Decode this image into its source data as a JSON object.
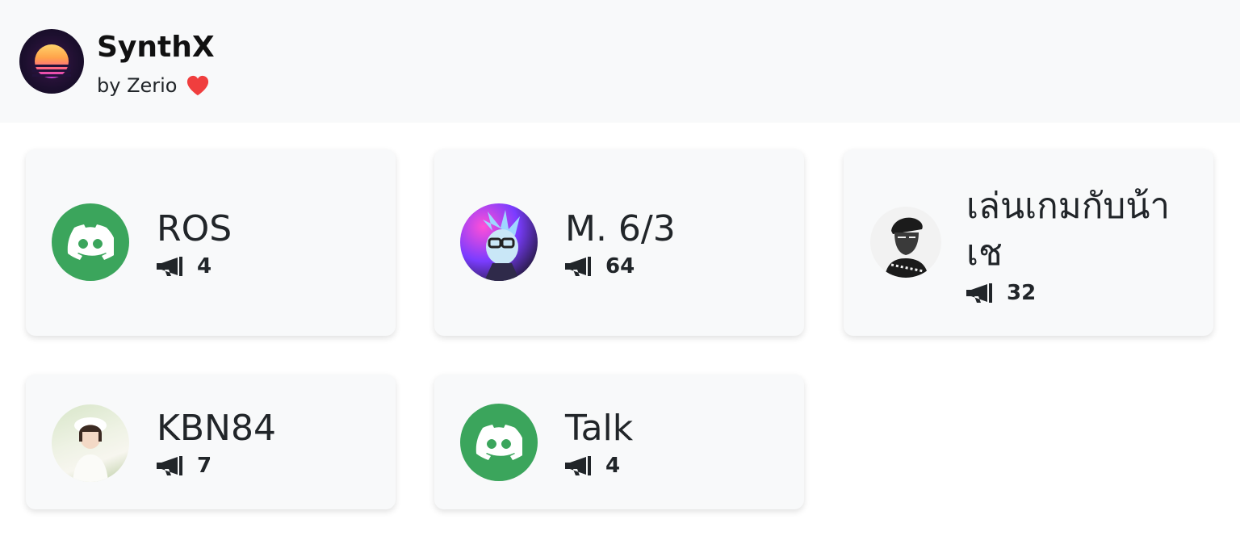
{
  "header": {
    "app_name": "SynthX",
    "byline": "by Zerio",
    "logo_icon": "synthwave-sun-logo",
    "heart_icon": "heart-icon",
    "heart_color": "#f03e3e",
    "background": "#f8f9fa"
  },
  "colors": {
    "card_bg": "#f8f9fa",
    "discord_green": "#3ba55c",
    "text": "#212529"
  },
  "servers": [
    {
      "name": "ROS",
      "members": "4",
      "avatar": "discord-icon"
    },
    {
      "name": "M. 6/3",
      "members": "64",
      "avatar": "rick-avatar"
    },
    {
      "name": "เล่นเกมกับน้าเช",
      "members": "32",
      "avatar": "che-avatar"
    },
    {
      "name": "KBN84",
      "members": "7",
      "avatar": "photo-avatar"
    },
    {
      "name": "Talk",
      "members": "4",
      "avatar": "discord-icon"
    }
  ]
}
